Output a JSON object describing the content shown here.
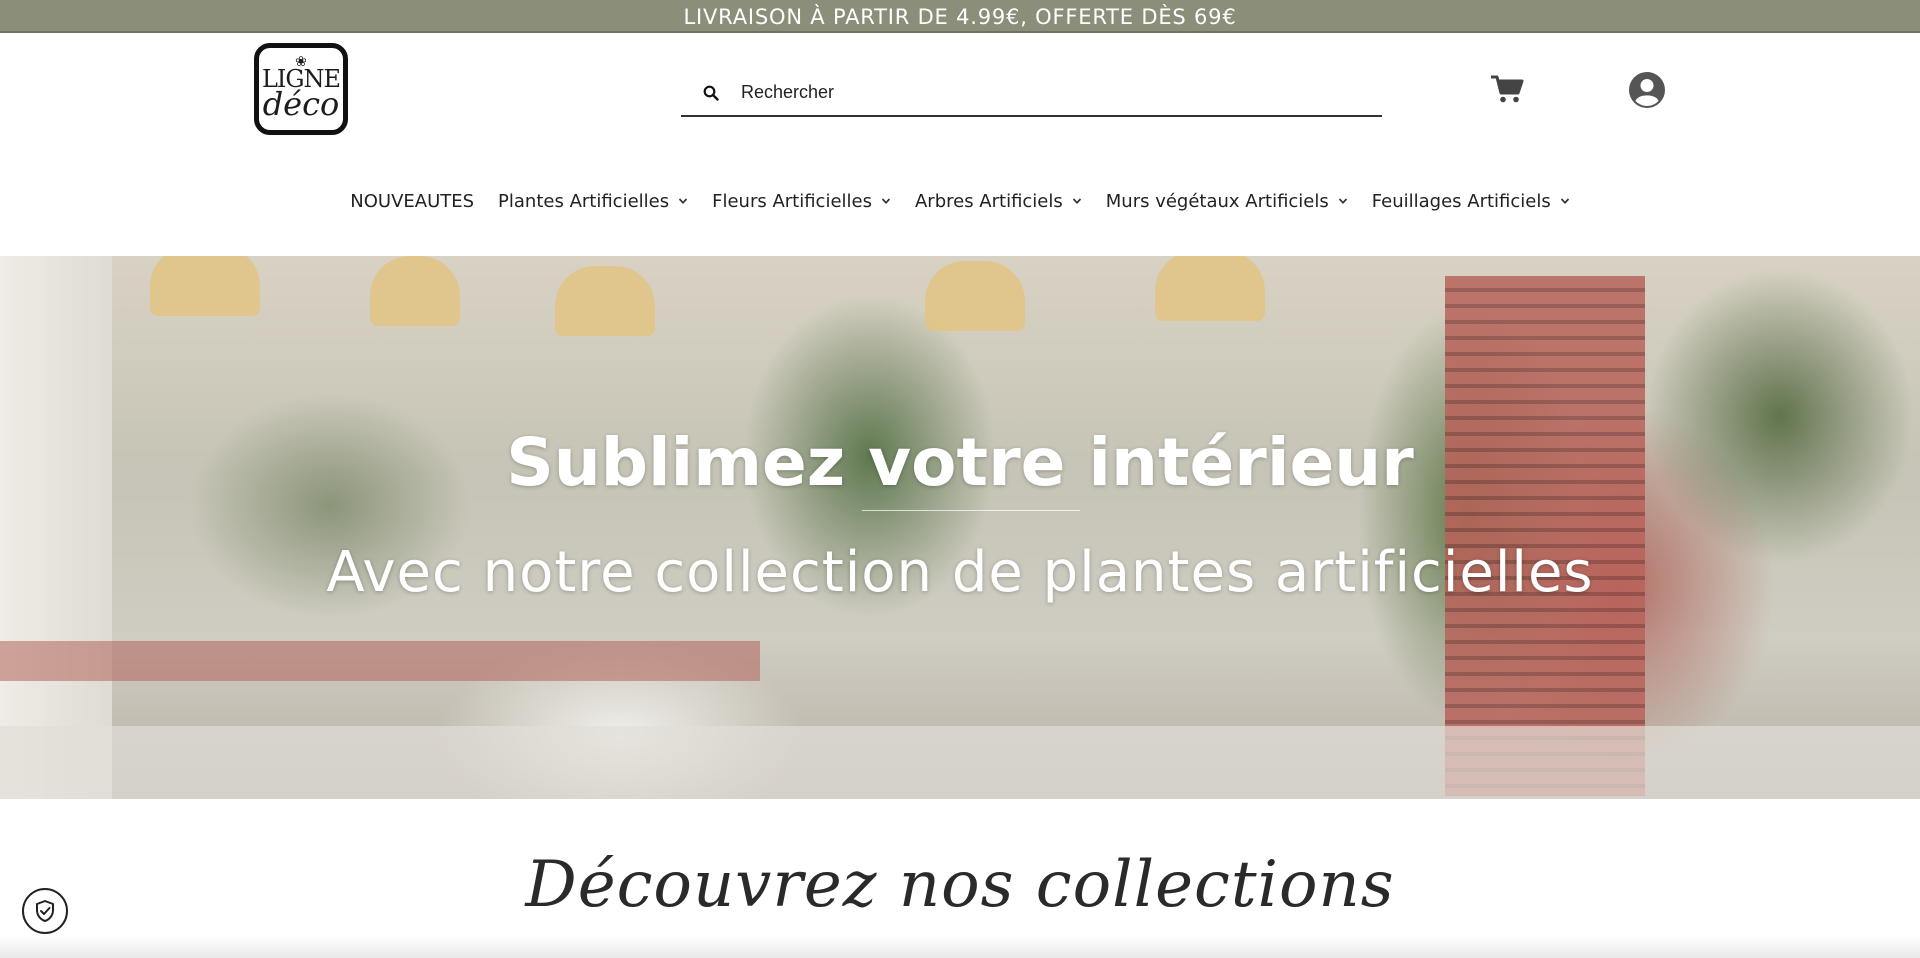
{
  "announcement": {
    "text": "LIVRAISON À PARTIR DE 4.99€, OFFERTE DÈS 69€"
  },
  "logo": {
    "line1": "LIGNE",
    "line2": "déco"
  },
  "search": {
    "placeholder": "Rechercher"
  },
  "icons": {
    "search": "search-icon",
    "cart": "cart-icon",
    "account": "user-circle-icon",
    "privacy": "shield-check-icon"
  },
  "nav": {
    "items": [
      {
        "label": "NOUVEAUTES",
        "has_dropdown": false
      },
      {
        "label": "Plantes Artificielles",
        "has_dropdown": true
      },
      {
        "label": "Fleurs Artificielles",
        "has_dropdown": true
      },
      {
        "label": "Arbres Artificiels",
        "has_dropdown": true
      },
      {
        "label": "Murs végétaux Artificiels",
        "has_dropdown": true
      },
      {
        "label": "Feuillages Artificiels",
        "has_dropdown": true
      }
    ]
  },
  "hero": {
    "title": "Sublimez votre intérieur",
    "subtitle": "Avec notre collection de plantes artificielles"
  },
  "collections": {
    "title": "Découvrez nos collections"
  },
  "colors": {
    "topbar": "#8b8f7a",
    "text": "#1c1c1c",
    "white": "#ffffff"
  }
}
